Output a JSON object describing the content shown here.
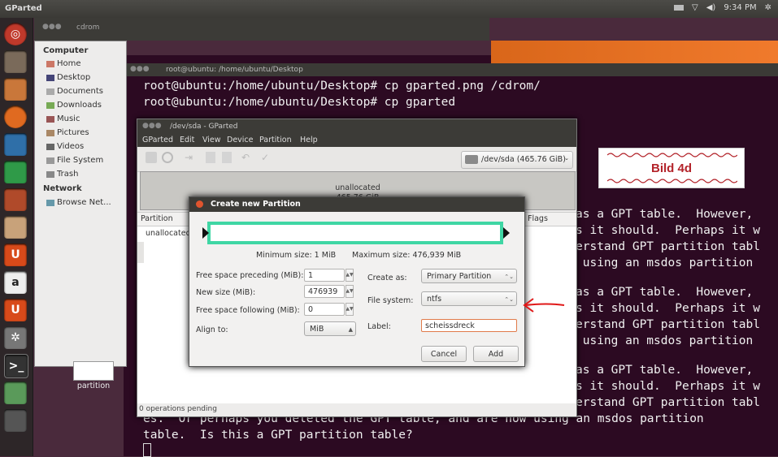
{
  "top_panel": {
    "app_name": "GParted",
    "time": "9:34 PM"
  },
  "file_manager": {
    "title": "cdrom",
    "sections": [
      {
        "heading": "Computer",
        "items": [
          "Home",
          "Desktop",
          "Documents",
          "Downloads",
          "Music",
          "Pictures",
          "Videos",
          "File System",
          "Trash"
        ]
      },
      {
        "heading": "Network",
        "items": [
          "Browse Net..."
        ]
      }
    ],
    "desktop_icon_label": "partition"
  },
  "terminal": {
    "title": "root@ubuntu: /home/ubuntu/Desktop",
    "lines": [
      "root@ubuntu:/home/ubuntu/Desktop# cp gparted.png /cdrom/",
      "root@ubuntu:/home/ubuntu/Desktop# cp gparted"
    ],
    "right_block": [
      "as a GPT table.  However,",
      "s it should.  Perhaps it w",
      "erstand GPT partition tabl",
      " using an msdos partition"
    ],
    "bottom_lines": [
      "es.  Or perhaps you deleted the GPT table, and are now using an msdos partition",
      "table.  Is this a GPT partition table?"
    ]
  },
  "gparted": {
    "title": "/dev/sda - GParted",
    "menu": [
      "GParted",
      "Edit",
      "View",
      "Device",
      "Partition",
      "Help"
    ],
    "device_selector": "/dev/sda  (465.76 GiB)",
    "graph_label": "unallocated",
    "graph_size": "465.76 GiB",
    "columns": [
      "Partition",
      "Flags"
    ],
    "rows": [
      "unallocated"
    ],
    "status": "0 operations pending"
  },
  "dialog": {
    "title": "Create new Partition",
    "min_size": "Minimum size: 1 MiB",
    "max_size": "Maximum size: 476,939 MiB",
    "fields": {
      "free_preceding": {
        "label": "Free space preceding (MiB):",
        "value": "1"
      },
      "new_size": {
        "label": "New size (MiB):",
        "value": "476939"
      },
      "free_following": {
        "label": "Free space following (MiB):",
        "value": "0"
      },
      "align_to": {
        "label": "Align to:",
        "value": "MiB"
      }
    },
    "create_as": {
      "label": "Create as:",
      "value": "Primary Partition"
    },
    "file_system": {
      "label": "File system:",
      "value": "ntfs"
    },
    "label": {
      "label": "Label:",
      "value": "scheissdreck"
    },
    "buttons": {
      "cancel": "Cancel",
      "add": "Add"
    }
  },
  "annotation": {
    "text": "Bild 4d",
    "color": "#b3232a",
    "arrow_color": "#e01818"
  }
}
